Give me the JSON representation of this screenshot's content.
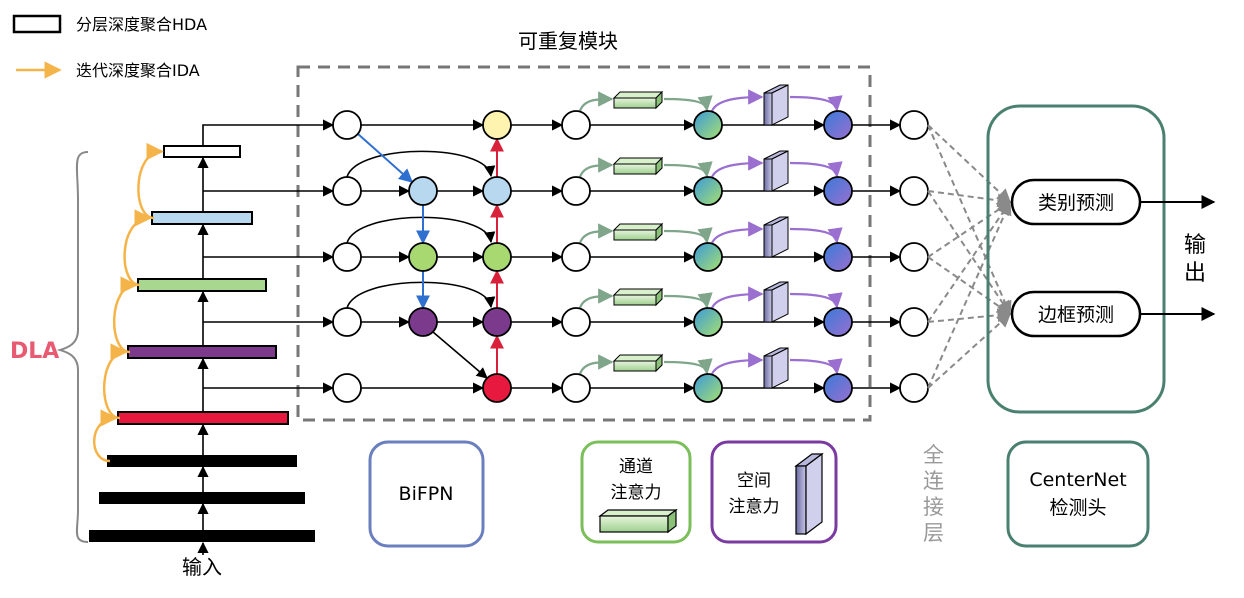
{
  "legend": {
    "hda_label": "分层深度聚合HDA",
    "ida_label": "迭代深度聚合IDA"
  },
  "dla": {
    "label": "DLA",
    "input_label": "输入"
  },
  "module_title": "可重复模块",
  "fc_label": [
    "全",
    "连",
    "接",
    "层"
  ],
  "boxes": {
    "bifpn": "BiFPN",
    "channel_attention": [
      "通道",
      "注意力"
    ],
    "spatial_attention": [
      "空间",
      "注意力"
    ],
    "centernet": [
      "CenterNet",
      "检测头"
    ]
  },
  "head": {
    "class_pred": "类别预测",
    "box_pred": "边框预测"
  },
  "output_label": [
    "输",
    "出"
  ],
  "colors": {
    "hda_levels": [
      "#000000",
      "#000000",
      "#000000",
      "#e8193e",
      "#7b3a8c",
      "#a8d890",
      "#b8d8f0",
      "#ffffff"
    ],
    "ida_arrow": "#f5b44a",
    "dla_text": "#e85a71",
    "bifpn_nodes": [
      "#fff3b0",
      "#b8d8f0",
      "#a8d870",
      "#7b3a8c",
      "#e8193e"
    ],
    "bifpn_border": "#6b7fbf",
    "channel_border": "#7bbf5a",
    "spatial_border": "#7a3aa0",
    "centernet_border": "#4a8070",
    "top_down_arrow": "#2f6fd0",
    "bottom_up_arrow": "#d8203a",
    "channel_arrow": "#7fa68a",
    "spatial_arrow": "#9a6fd0",
    "fc_arrow": "#8a8a8a",
    "fc_text": "#999999"
  },
  "icons": {
    "channel_block": "green-slab-icon",
    "spatial_block": "purple-panel-icon"
  }
}
